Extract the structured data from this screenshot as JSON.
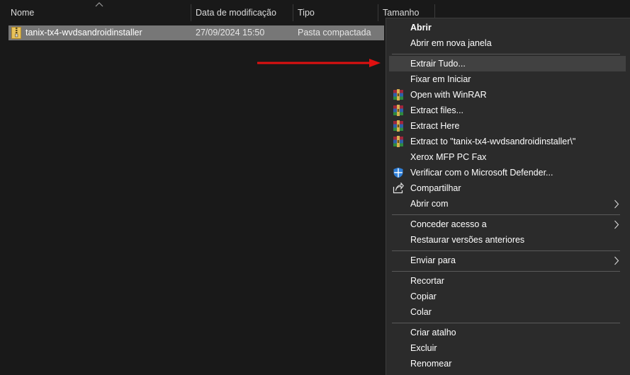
{
  "columns": {
    "name": "Nome",
    "date": "Data de modificação",
    "type": "Tipo",
    "size": "Tamanho"
  },
  "file": {
    "name": "tanix-tx4-wvdsandroidinstaller",
    "date": "27/09/2024 15:50",
    "type": "Pasta compactada",
    "icon": "zip-folder-icon"
  },
  "annotation": {
    "arrow_color": "#e01010"
  },
  "menu": {
    "items": {
      "open": "Abrir",
      "open_new_window": "Abrir em nova janela",
      "extract_all": "Extrair Tudo...",
      "pin_start": "Fixar em Iniciar",
      "open_winrar": "Open with WinRAR",
      "extract_files": "Extract files...",
      "extract_here": "Extract Here",
      "extract_to": "Extract to \"tanix-tx4-wvdsandroidinstaller\\\"",
      "xerox_fax": "Xerox MFP PC Fax",
      "defender": "Verificar com o Microsoft Defender...",
      "share": "Compartilhar",
      "open_with": "Abrir com",
      "grant_access": "Conceder acesso a",
      "restore_versions": "Restaurar versões anteriores",
      "send_to": "Enviar para",
      "cut": "Recortar",
      "copy": "Copiar",
      "paste": "Colar",
      "create_shortcut": "Criar atalho",
      "delete": "Excluir",
      "rename": "Renomear"
    }
  },
  "colors": {
    "background": "#191919",
    "menu_bg": "#2b2b2b",
    "highlight": "#414141",
    "selected_row": "#777777"
  }
}
